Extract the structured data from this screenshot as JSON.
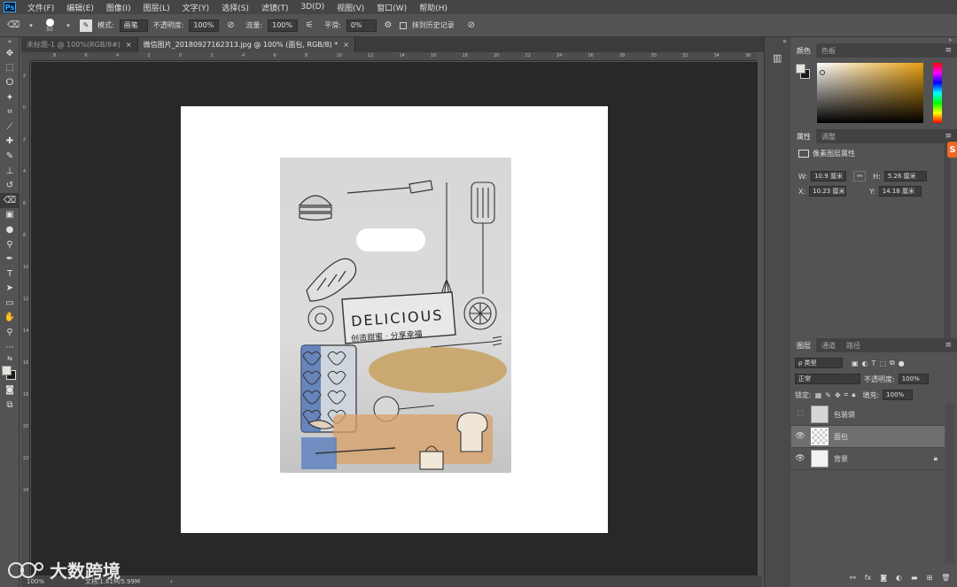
{
  "app": {
    "logo": "Ps"
  },
  "menu": [
    "文件(F)",
    "编辑(E)",
    "图像(I)",
    "图层(L)",
    "文字(Y)",
    "选择(S)",
    "滤镜(T)",
    "3D(D)",
    "视图(V)",
    "窗口(W)",
    "帮助(H)"
  ],
  "options": {
    "brush_size": "50",
    "mode_label": "模式:",
    "mode_value": "画笔",
    "opacity_label": "不透明度:",
    "opacity_value": "100%",
    "flow_label": "流量:",
    "flow_value": "100%",
    "smooth_label": "平滑:",
    "smooth_value": "0%",
    "history_label": "抹到历史记录"
  },
  "tabs": [
    {
      "label": "未标题-1 @ 100%(RGB/8#)",
      "close": "×"
    },
    {
      "label": "微信图片_20180927162313.jpg @ 100% (面包, RGB/8) *",
      "close": "×"
    }
  ],
  "ruler_top": [
    "8",
    "6",
    "4",
    "2",
    "0",
    "2",
    "4",
    "6",
    "8",
    "10",
    "12",
    "14",
    "16",
    "18",
    "20",
    "22",
    "24",
    "26",
    "28",
    "30",
    "32",
    "34",
    "36"
  ],
  "ruler_left": [
    "2",
    "0",
    "2",
    "4",
    "6",
    "8",
    "10",
    "12",
    "14",
    "16",
    "18",
    "20",
    "22",
    "24"
  ],
  "status": {
    "zoom": "100%",
    "doc": "文档:1.61M/5.99M",
    "arrow": "›"
  },
  "watermark": "大数跨境",
  "color_panel": {
    "tab1": "颜色",
    "tab2": "色板"
  },
  "props_panel": {
    "tab1": "属性",
    "tab2": "调整",
    "title": "像素图层属性",
    "w_label": "W:",
    "w_value": "10.9 厘米",
    "h_label": "H:",
    "h_value": "5.26 厘米",
    "x_label": "X:",
    "x_value": "10.23 厘米",
    "y_label": "Y:",
    "y_value": "14.18 厘米"
  },
  "layers_panel": {
    "tab1": "图层",
    "tab2": "通道",
    "tab3": "路径",
    "filter_value": "ρ 类型",
    "blend_value": "正常",
    "opacity_label": "不透明度:",
    "opacity_value": "100%",
    "lock_label": "锁定:",
    "fill_label": "填充:",
    "fill_value": "100%",
    "layers": [
      {
        "name": "包装袋",
        "visible": false,
        "selected": false,
        "locked": false
      },
      {
        "name": "面包",
        "visible": true,
        "selected": true,
        "locked": false
      },
      {
        "name": "背景",
        "visible": true,
        "selected": false,
        "locked": true
      }
    ]
  },
  "bag": {
    "text_main": "DELICIOUS",
    "text_sub": "创造甜蜜 · 分享幸福"
  },
  "colors": {
    "foreground": "#e6e2dc",
    "background": "#1a1a1a",
    "canvas_bg": "#282828",
    "panel_bg": "#535353",
    "selected_layer": "#6f6f6f"
  }
}
